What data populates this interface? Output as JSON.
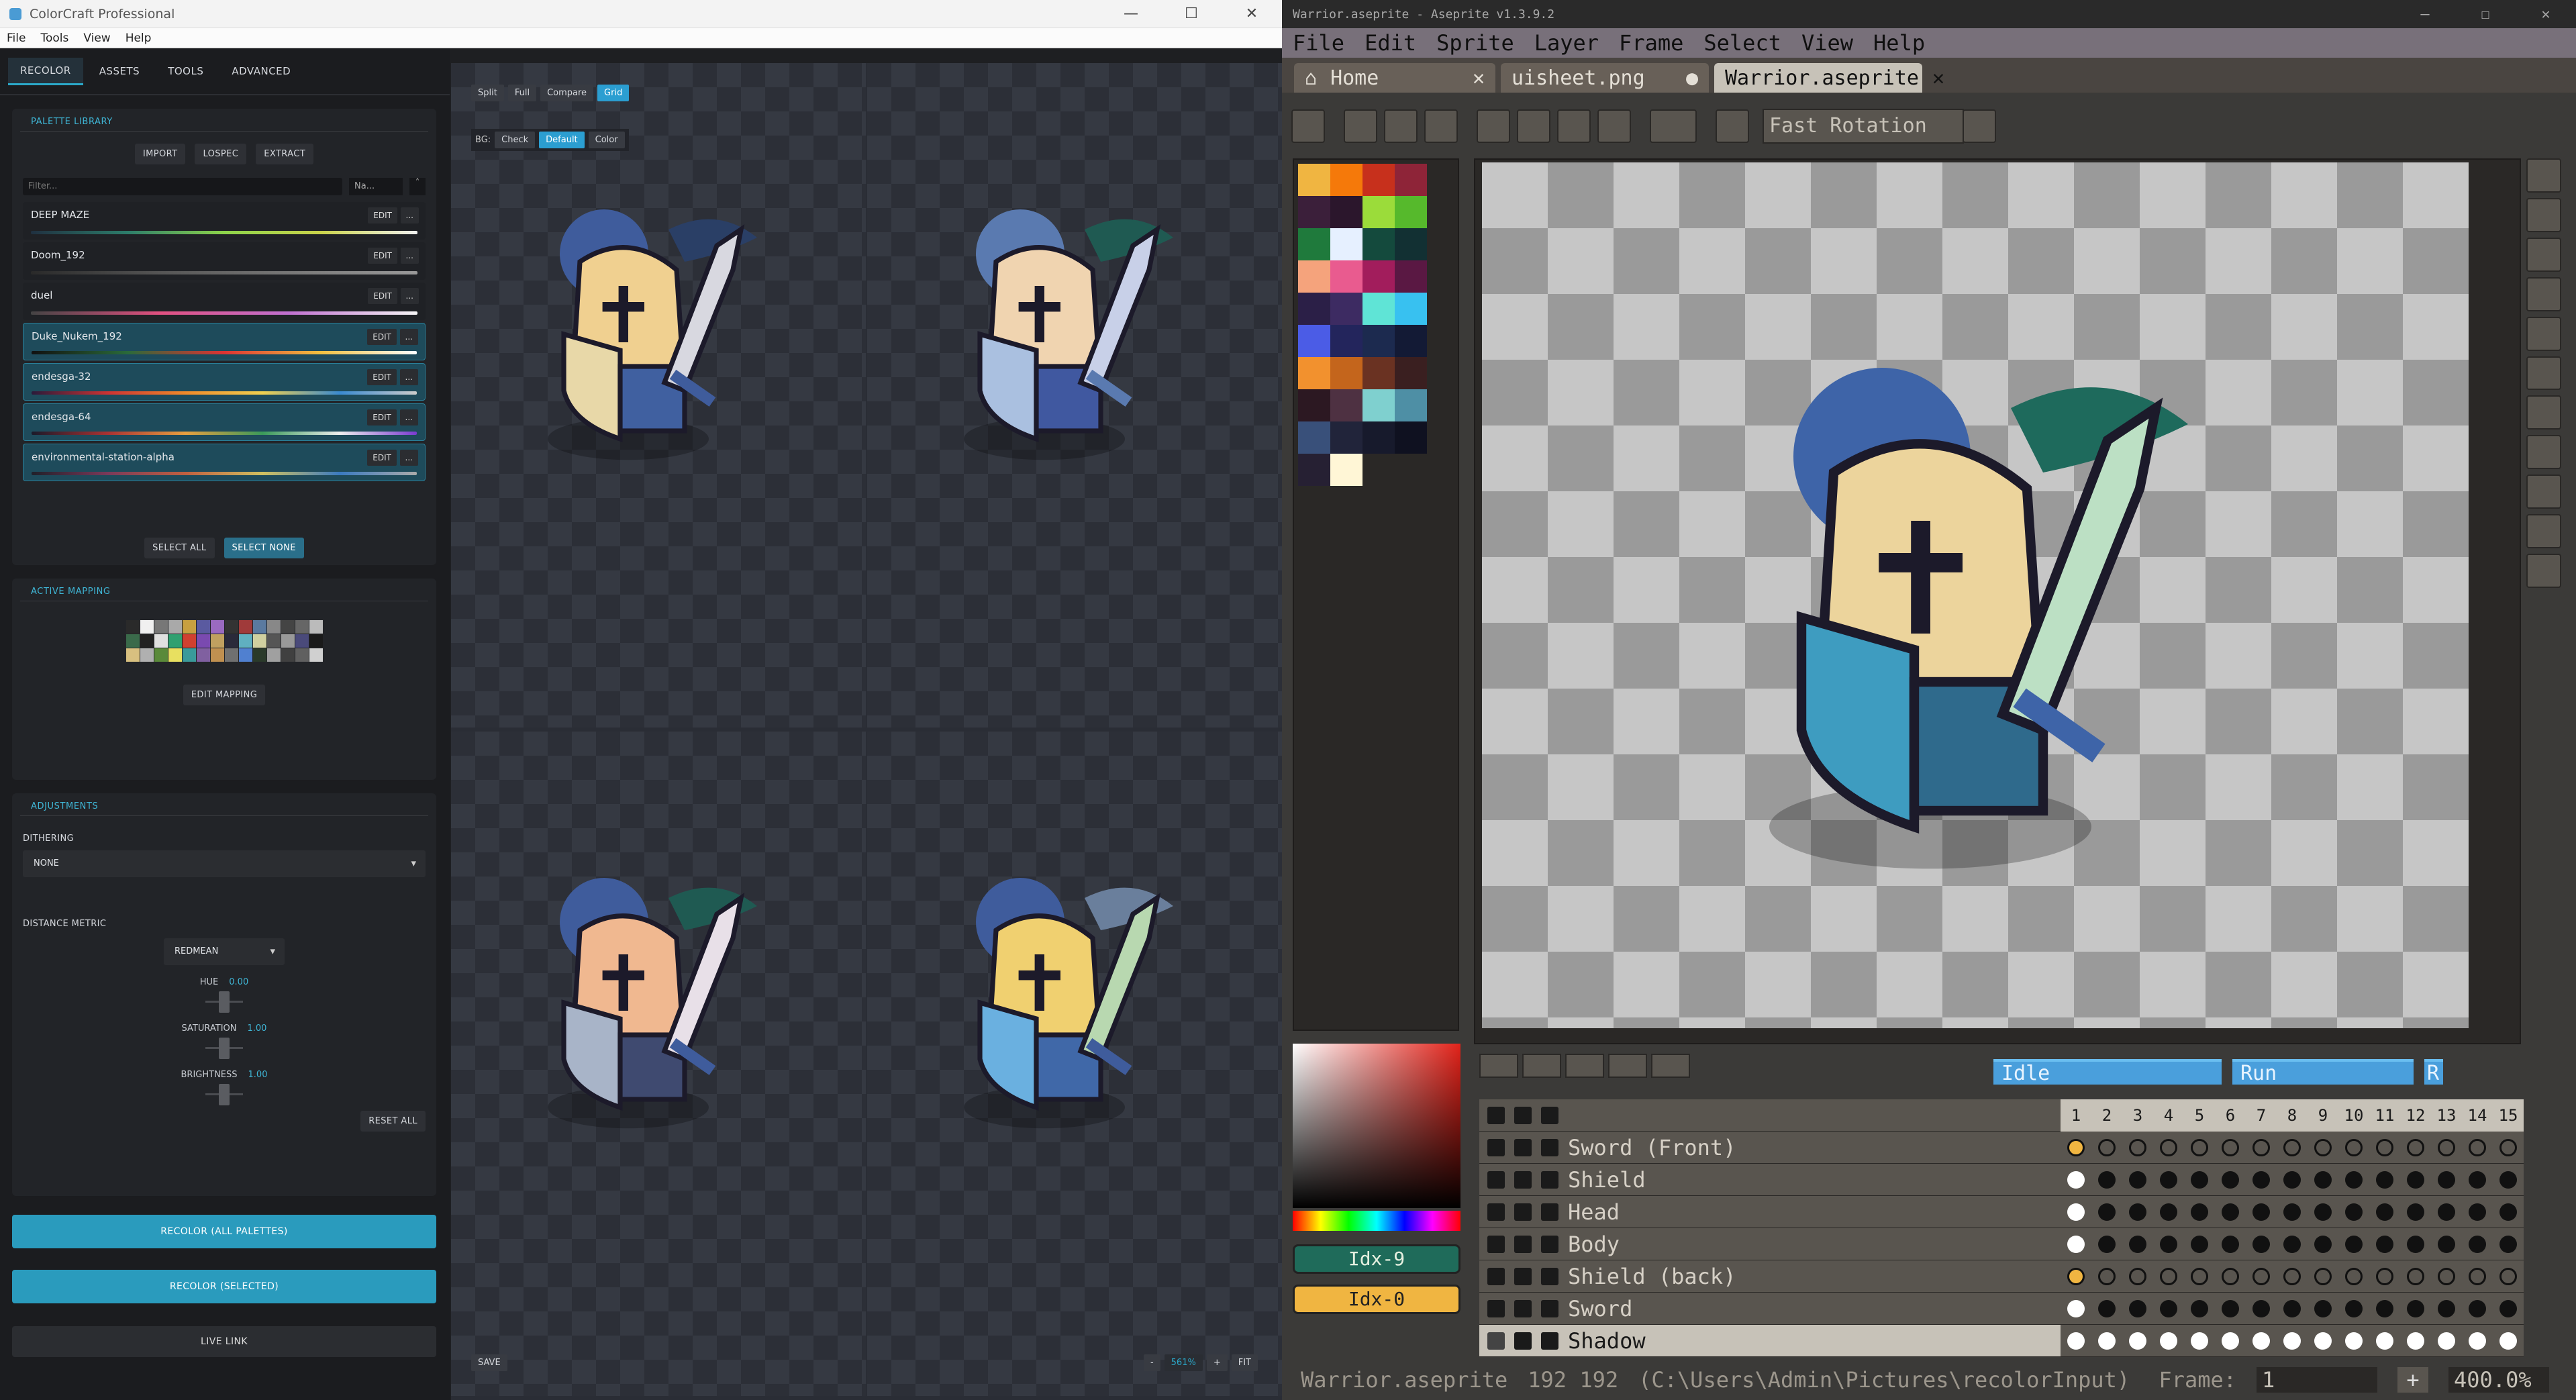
{
  "colorcraft": {
    "title": "ColorCraft Professional",
    "menu": [
      "File",
      "Tools",
      "View",
      "Help"
    ],
    "tabs": [
      "RECOLOR",
      "ASSETS",
      "TOOLS",
      "ADVANCED"
    ],
    "palette_library": {
      "title": "PALETTE LIBRARY",
      "buttons": [
        "IMPORT",
        "LOSPEC",
        "EXTRACT"
      ],
      "filter_placeholder": "Filter...",
      "sort": "Na...",
      "items": [
        {
          "name": "DEEP MAZE",
          "selected": false
        },
        {
          "name": "Doom_192",
          "selected": false
        },
        {
          "name": "duel",
          "selected": false
        },
        {
          "name": "Duke_Nukem_192",
          "selected": true
        },
        {
          "name": "endesga-32",
          "selected": true
        },
        {
          "name": "endesga-64",
          "selected": true
        },
        {
          "name": "environmental-station-alpha",
          "selected": true
        }
      ],
      "edit_label": "EDIT",
      "more_label": "...",
      "select_all": "SELECT ALL",
      "select_none": "SELECT NONE"
    },
    "active_mapping": {
      "title": "ACTIVE MAPPING",
      "edit_mapping": "EDIT MAPPING"
    },
    "adjustments": {
      "title": "ADJUSTMENTS",
      "dithering_label": "DITHERING",
      "dithering_value": "NONE",
      "distance_label": "DISTANCE METRIC",
      "distance_value": "REDMEAN",
      "hue_label": "HUE",
      "hue_value": "0.00",
      "saturation_label": "SATURATION",
      "saturation_value": "1.00",
      "brightness_label": "BRIGHTNESS",
      "brightness_value": "1.00",
      "reset_all": "RESET ALL"
    },
    "actions": {
      "recolor_all": "RECOLOR (ALL PALETTES)",
      "recolor_selected": "RECOLOR (SELECTED)",
      "live_link": "LIVE LINK"
    },
    "view": {
      "mode_buttons": [
        "Split",
        "Full",
        "Compare",
        "Grid"
      ],
      "active_mode": "Grid",
      "bg_label": "BG:",
      "bg_buttons": [
        "Check",
        "Default",
        "Color"
      ],
      "active_bg": "Default",
      "save": "SAVE",
      "zoom_minus": "-",
      "zoom_value": "561%",
      "zoom_plus": "+",
      "fit": "FIT"
    }
  },
  "aseprite": {
    "title": "Warrior.aseprite - Aseprite v1.3.9.2",
    "menu": [
      "File",
      "Edit",
      "Sprite",
      "Layer",
      "Frame",
      "Select",
      "View",
      "Help"
    ],
    "tabs": [
      {
        "label": "Home",
        "active": false
      },
      {
        "label": "uisheet.png",
        "active": false
      },
      {
        "label": "Warrior.aseprite",
        "active": true
      }
    ],
    "rotation_mode": "Fast Rotation",
    "palette_colors": [
      "#f0b541",
      "#f5790a",
      "#c7301c",
      "#8e2438",
      "#3b1f3a",
      "#2b162c",
      "#9bdc3a",
      "#56b92c",
      "#1f7a3c",
      "#e6f0ff",
      "#144a3d",
      "#123033",
      "#f5a37c",
      "#e95b8f",
      "#a21d5c",
      "#5a1843",
      "#2b1f47",
      "#3d2b62",
      "#5fe4d6",
      "#38c1f0",
      "#4b5ce6",
      "#23255c",
      "#1c2a4f",
      "#131a35",
      "#f2912e",
      "#c4651c",
      "#6a3222",
      "#3a1f20",
      "#2c1822",
      "#4e3142",
      "#7fd0cf",
      "#4e8fa5",
      "#39507a",
      "#21243a",
      "#171a2c",
      "#0f1120",
      "#262033",
      "#fff6d6"
    ],
    "fg_label": "Idx-9",
    "bg_label": "Idx-0",
    "tags": [
      "Idle",
      "Run",
      "R"
    ],
    "layers": [
      "Sword (Front)",
      "Shield",
      "Head",
      "Body",
      "Shield (back)",
      "Sword",
      "Shadow"
    ],
    "selected_layer": "Shadow",
    "frame_numbers": [
      "1",
      "2",
      "3",
      "4",
      "5",
      "6",
      "7",
      "8",
      "9",
      "10",
      "11",
      "12",
      "13",
      "14",
      "15"
    ],
    "status": {
      "filename": "Warrior.aseprite",
      "size": "192 192",
      "path": "(C:\\Users\\Admin\\Pictures\\recolorInput)",
      "frame_label": "Frame:",
      "frame_value": "1",
      "zoom": "400.0%"
    }
  },
  "colors": {
    "accent": "#2ba8c9",
    "ase_tag": "#4a9fdc"
  }
}
